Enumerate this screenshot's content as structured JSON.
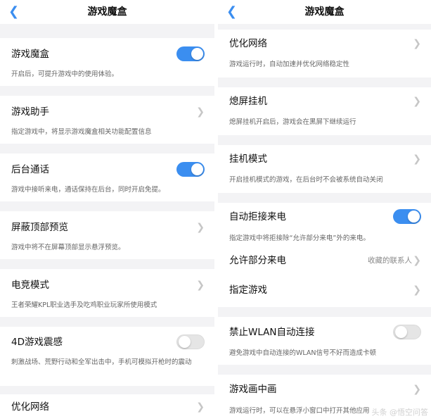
{
  "left": {
    "back_icon": "chevron-left-icon",
    "title": "游戏魔盒",
    "game_box": {
      "label": "游戏魔盒",
      "desc": "开启后，可提升游戏中的使用体验。",
      "enabled": true
    },
    "game_assistant": {
      "label": "游戏助手",
      "desc": "指定游戏中，将显示游戏魔盒相关功能配置信息"
    },
    "background_call": {
      "label": "后台通话",
      "desc": "游戏中接听来电，通话保持在后台，同时开启免提。",
      "enabled": true
    },
    "block_top_preview": {
      "label": "屏蔽顶部预览",
      "desc": "游戏中将不在屏幕顶部显示悬浮预览。"
    },
    "esports_mode": {
      "label": "电竞模式",
      "desc": "王者荣耀KPL职业选手及吃鸡职业玩家所使用模式"
    },
    "vibration_4d": {
      "label": "4D游戏震感",
      "desc": "刺激战场、荒野行动和全军出击中，手机可模拟开枪时的震动",
      "enabled": false
    },
    "optimize_network": {
      "label": "优化网络"
    }
  },
  "right": {
    "back_icon": "chevron-left-icon",
    "title": "游戏魔盒",
    "optimize_network": {
      "label": "优化网络",
      "desc": "游戏运行时，自动加速并优化网络稳定性"
    },
    "screen_off_hangup": {
      "label": "熄屏挂机",
      "desc": "熄屏挂机开启后，游戏会在黑屏下继续运行"
    },
    "hangup_mode": {
      "label": "挂机模式",
      "desc": "开启挂机模式的游戏，在后台时不会被系统自动关闭"
    },
    "auto_reject_calls": {
      "label": "自动拒接来电",
      "desc": "指定游戏中将拒接除“允许部分来电”外的来电。",
      "enabled": true
    },
    "allow_some_calls": {
      "label": "允许部分来电",
      "value": "收藏的联系人"
    },
    "specified_games": {
      "label": "指定游戏"
    },
    "disable_wlan_auto": {
      "label": "禁止WLAN自动连接",
      "desc": "避免游戏中自动连接的WLAN信号不好而造成卡顿",
      "enabled": false
    },
    "game_pip": {
      "label": "游戏画中画",
      "desc": "游戏运行时，可以在悬浮小窗口中打开其他应用"
    }
  },
  "watermark": "头条 @悟空问答",
  "colors": {
    "accent": "#3b8ef0",
    "background": "#f3f3f5",
    "card": "#ffffff"
  }
}
